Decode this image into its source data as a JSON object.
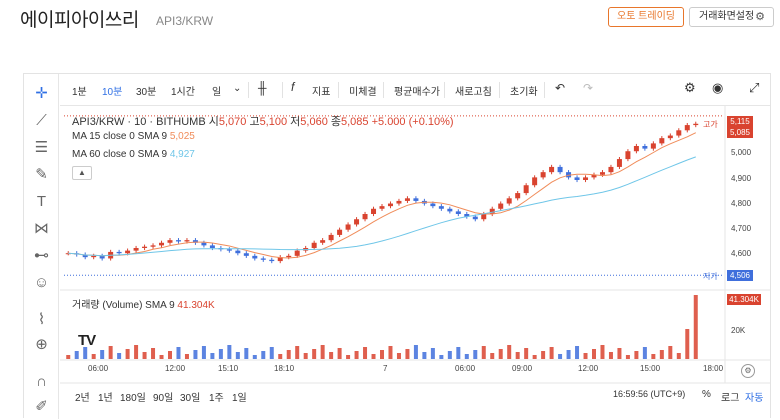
{
  "header": {
    "coin_name": "에이피아이쓰리",
    "coin_code": "API3/KRW",
    "auto_trading_label": "오토 트레이딩",
    "settings_label": "거래화면설정"
  },
  "toolbar": {
    "intervals": [
      "1분",
      "10분",
      "30분",
      "1시간",
      "일"
    ],
    "selected_interval": "10분",
    "indicator_label": "지표",
    "items": [
      "미체결",
      "평균매수가",
      "새로고침",
      "초기화"
    ]
  },
  "legend": {
    "symbol": "API3/KRW · 10 · BITHUMB",
    "open_label": "시",
    "open": "5,070",
    "high_label": "고",
    "high": "5,100",
    "low_label": "저",
    "low": "5,060",
    "close_label": "종",
    "close": "5,085",
    "change": "+5.000 (+0.10%)",
    "ma15_label": "MA 15 close 0 SMA 9",
    "ma15_value": "5,025",
    "ma60_label": "MA 60 close 0 SMA 9",
    "ma60_value": "4,927"
  },
  "volume_legend": {
    "label": "거래량 (Volume) SMA 9",
    "value": "41.304K"
  },
  "price_axis": {
    "ticks": [
      "5,000",
      "4,900",
      "4,800",
      "4,700",
      "4,600"
    ],
    "high_tag": "5,115",
    "current_tag": "5,085",
    "low_tag": "4,506",
    "high_label": "고가",
    "low_label": "저가",
    "volume_tag": "41.304K",
    "volume_tick": "20K"
  },
  "time_axis": [
    "06:00",
    "12:00",
    "15:10",
    "18:10",
    "7",
    "06:00",
    "09:00",
    "12:00",
    "15:00",
    "18:00"
  ],
  "bottom": {
    "ranges": [
      "2년",
      "1년",
      "180일",
      "90일",
      "30일",
      "1주",
      "1일"
    ],
    "clock": "16:59:56 (UTC+9)",
    "percent_label": "%",
    "log_label": "로그",
    "auto_label": "자동"
  },
  "colors": {
    "up": "#d9432f",
    "down": "#3f6fdc",
    "ma15": "#f08c5a",
    "ma60": "#6fc6e8",
    "accent": "#e8762b"
  },
  "chart_data": {
    "type": "candlestick",
    "ylim": [
      4480,
      5130
    ],
    "closes": [
      4590,
      4585,
      4575,
      4580,
      4570,
      4595,
      4590,
      4600,
      4610,
      4615,
      4620,
      4630,
      4640,
      4635,
      4640,
      4630,
      4620,
      4610,
      4605,
      4600,
      4590,
      4580,
      4570,
      4565,
      4560,
      4575,
      4580,
      4600,
      4610,
      4630,
      4640,
      4660,
      4680,
      4700,
      4720,
      4740,
      4760,
      4770,
      4780,
      4790,
      4800,
      4790,
      4780,
      4770,
      4760,
      4750,
      4740,
      4730,
      4720,
      4740,
      4760,
      4780,
      4800,
      4820,
      4850,
      4880,
      4900,
      4920,
      4900,
      4880,
      4870,
      4880,
      4890,
      4900,
      4920,
      4950,
      4980,
      5000,
      4990,
      5010,
      5030,
      5040,
      5060,
      5080,
      5085
    ],
    "volume_max": 45000
  }
}
